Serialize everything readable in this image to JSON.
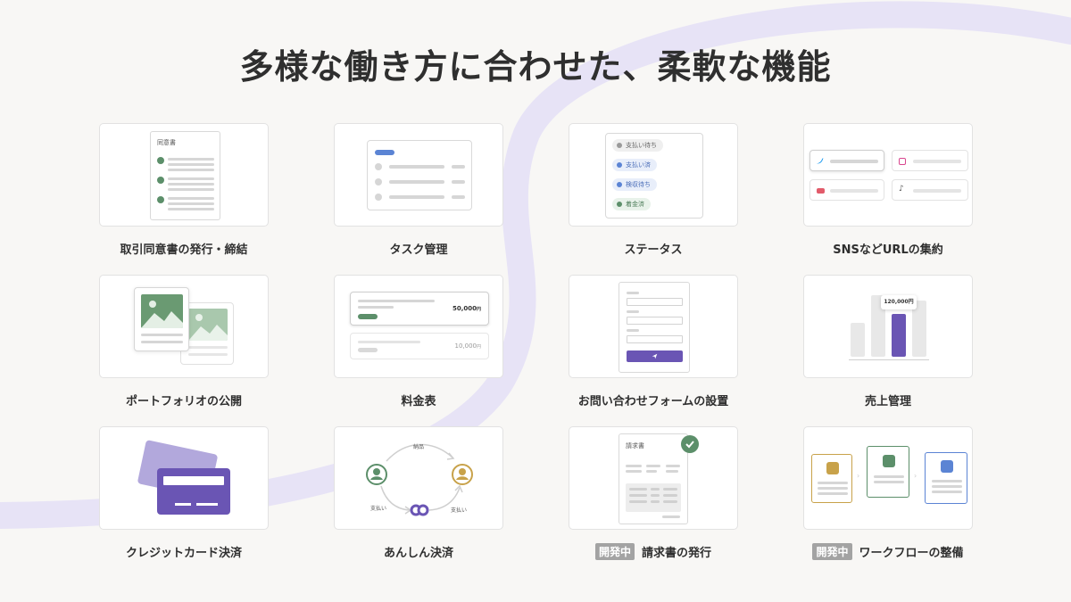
{
  "page": {
    "title": "多様な働き方に合わせた、柔軟な機能"
  },
  "colors": {
    "accent": "#6a55b4",
    "green": "#5c8f6a",
    "blue": "#5b84d4",
    "gold": "#c8a24a",
    "background_curve": "#e7e3f6"
  },
  "features": [
    {
      "caption": "取引同意書の発行・締結",
      "in_development": false,
      "illustration": {
        "doc_title": "同意書"
      }
    },
    {
      "caption": "タスク管理",
      "in_development": false
    },
    {
      "caption": "ステータス",
      "in_development": false,
      "illustration": {
        "statuses": [
          "支払い待ち",
          "支払い済",
          "検収待ち",
          "着金済"
        ]
      }
    },
    {
      "caption": "SNSなどURLの集約",
      "in_development": false,
      "illustration": {
        "icons": [
          "twitter-icon",
          "instagram-icon",
          "youtube-icon",
          "tiktok-icon"
        ]
      }
    },
    {
      "caption": "ポートフォリオの公開",
      "in_development": false
    },
    {
      "caption": "料金表",
      "in_development": false,
      "illustration": {
        "prices": [
          {
            "amount": "50,000",
            "unit": "円"
          },
          {
            "amount": "10,000",
            "unit": "円"
          }
        ]
      }
    },
    {
      "caption": "お問い合わせフォームの設置",
      "in_development": false
    },
    {
      "caption": "売上管理",
      "in_development": false,
      "illustration": {
        "tooltip": "120,000円"
      }
    },
    {
      "caption": "クレジットカード決済",
      "in_development": false
    },
    {
      "caption": "あんしん決済",
      "in_development": false,
      "illustration": {
        "labels": [
          "納品",
          "支払い",
          "支払い"
        ]
      }
    },
    {
      "caption": "請求書の発行",
      "in_development": true,
      "badge": "開発中",
      "illustration": {
        "doc_title": "請求書"
      }
    },
    {
      "caption": "ワークフローの整備",
      "in_development": true,
      "badge": "開発中"
    }
  ]
}
